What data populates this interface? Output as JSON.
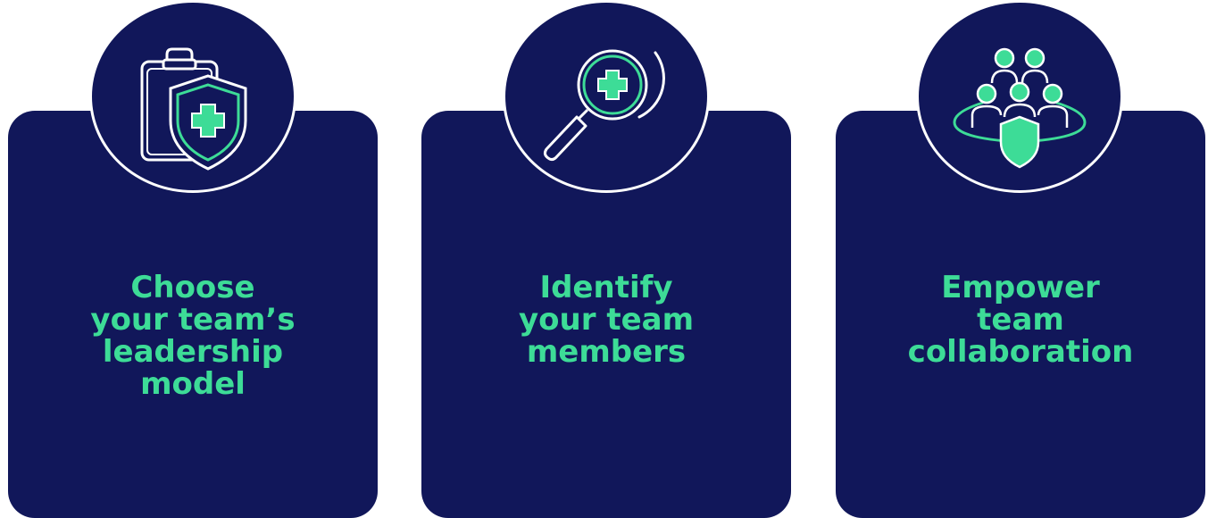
{
  "colors": {
    "card_bg": "#11175a",
    "accent": "#3ddc97",
    "outline": "#ffffff"
  },
  "cards": [
    {
      "icon": "clipboard-shield-cross-icon",
      "title_lines": [
        "Choose",
        "your team’s",
        "leadership",
        "model"
      ]
    },
    {
      "icon": "magnifier-cross-icon",
      "title_lines": [
        "Identify",
        "your team",
        "members"
      ]
    },
    {
      "icon": "team-shield-icon",
      "title_lines": [
        "Empower",
        "team",
        "collaboration"
      ]
    }
  ]
}
